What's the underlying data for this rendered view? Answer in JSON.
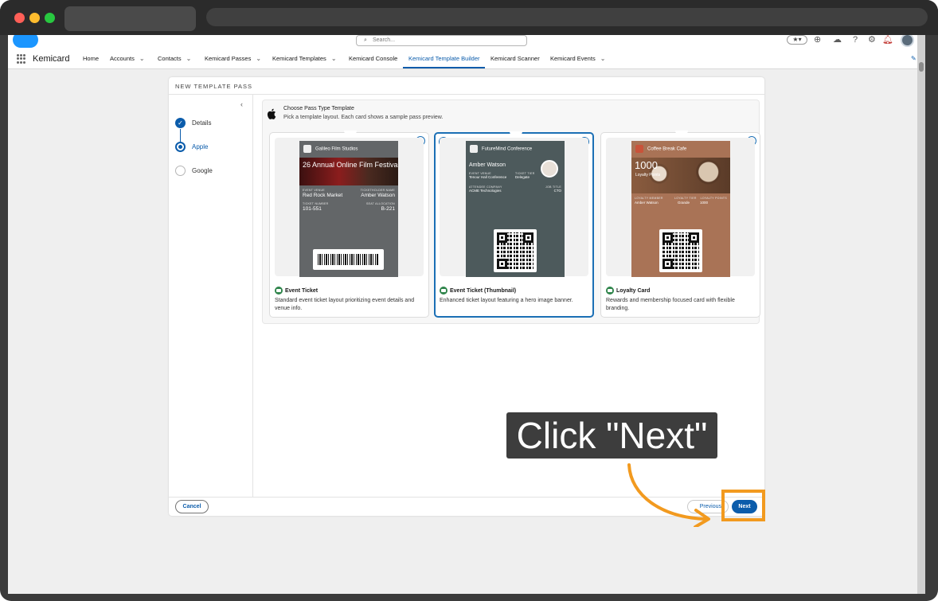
{
  "browser": {},
  "salesforce": {
    "search_placeholder": "Search...",
    "search_icon": "search-icon",
    "app_name": "Kemicard",
    "nav_items": [
      {
        "label": "Home",
        "has_menu": false
      },
      {
        "label": "Accounts",
        "has_menu": true
      },
      {
        "label": "Contacts",
        "has_menu": true
      },
      {
        "label": "Kemicard Passes",
        "has_menu": true
      },
      {
        "label": "Kemicard Templates",
        "has_menu": true
      },
      {
        "label": "Kemicard Console",
        "has_menu": false
      },
      {
        "label": "Kemicard Template Builder",
        "has_menu": false,
        "active": true
      },
      {
        "label": "Kemicard Scanner",
        "has_menu": false
      },
      {
        "label": "Kemicard Events",
        "has_menu": true
      }
    ],
    "accent_color": "#0b5cab"
  },
  "modal": {
    "title": "NEW TEMPLATE PASS",
    "steps": [
      {
        "label": "Details",
        "state": "done"
      },
      {
        "label": "Apple",
        "state": "current"
      },
      {
        "label": "Google",
        "state": "todo"
      }
    ],
    "section_title": "Choose Pass Type Template",
    "section_subtitle": "Pick a template layout. Each card shows a sample pass preview.",
    "templates": [
      {
        "name": "Event Ticket",
        "description": "Standard event ticket layout prioritizing event details and venue info.",
        "selected": false,
        "pass": {
          "header": "Galileo Film Studios",
          "strip_text": "26 Annual Online Film Festival",
          "f1_label": "EVENT VENUE",
          "f1_value": "Red Rock Market",
          "f2_label": "TICKETHOLDER NAME",
          "f2_value": "Amber Watson",
          "f3_label": "TICKET NUMBER",
          "f3_value": "101-551",
          "f4_label": "SEAT ALLOCATION",
          "f4_value": "B-221",
          "bg": "#636668"
        }
      },
      {
        "name": "Event Ticket (Thumbnail)",
        "description": "Enhanced ticket layout featuring a hero image banner.",
        "selected": true,
        "pass": {
          "header": "FutureMind Conference",
          "primary": "Amber Watson",
          "f1_label": "EVENT VENUE",
          "f1_value": "Tenour Hall Conference",
          "f2_label": "TICKET TIER",
          "f2_value": "Delegate",
          "f3_label": "ATTENDEE COMPANY",
          "f3_value": "ACME Technologies",
          "f4_label": "JOB TITLE",
          "f4_value": "CTO",
          "bg": "#4d5a5c"
        }
      },
      {
        "name": "Loyalty Card",
        "description": "Rewards and membership focused card with flexible branding.",
        "selected": false,
        "pass": {
          "header": "Coffee Break Cafe",
          "strip_big": "1000",
          "strip_small": "Loyalty Points",
          "f1_label": "LOYALTY MEMBER",
          "f1_value": "Amber Watson",
          "f2_label": "LOYALTY TIER",
          "f2_value": "Grande",
          "f3_label": "LOYALTY POINTS",
          "f3_value": "1000",
          "bg": "#a97356"
        }
      }
    ],
    "cancel_label": "Cancel",
    "previous_label": "Previous",
    "next_label": "Next"
  },
  "annotation": {
    "callout_text": "Click \"Next\"",
    "highlight_color": "#f29a1f"
  }
}
